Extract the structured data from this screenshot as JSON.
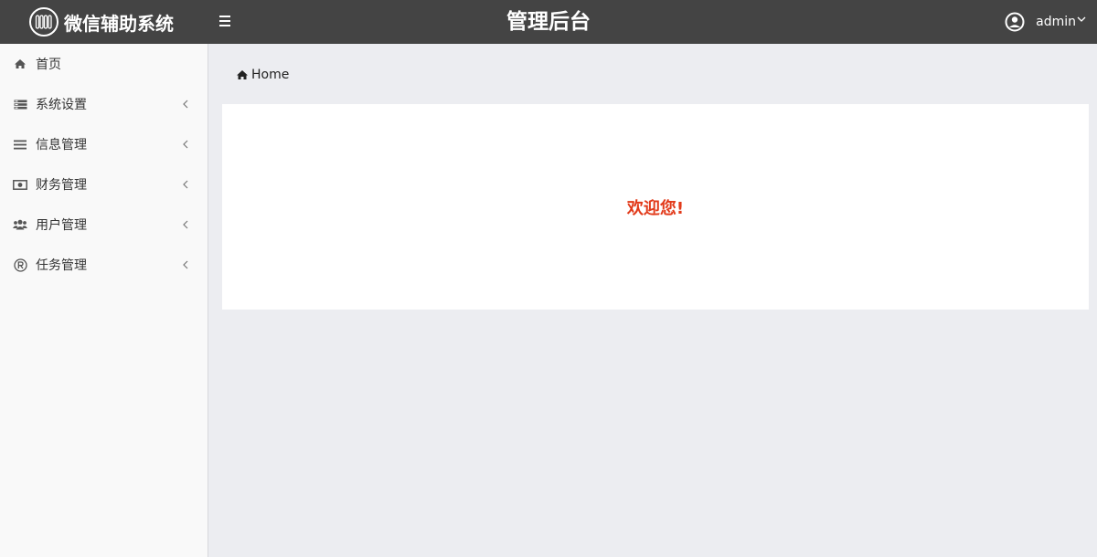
{
  "header": {
    "brand_title": "微信辅助系统",
    "center_title": "管理后台",
    "user_name": "admin"
  },
  "sidebar": {
    "items": [
      {
        "label": "首页",
        "icon": "home-icon",
        "has_submenu": false
      },
      {
        "label": "系统设置",
        "icon": "server-icon",
        "has_submenu": true
      },
      {
        "label": "信息管理",
        "icon": "list-icon",
        "has_submenu": true
      },
      {
        "label": "财务管理",
        "icon": "money-icon",
        "has_submenu": true
      },
      {
        "label": "用户管理",
        "icon": "users-icon",
        "has_submenu": true
      },
      {
        "label": "任务管理",
        "icon": "registered-icon",
        "has_submenu": true
      }
    ]
  },
  "breadcrumb": {
    "home_label": "Home"
  },
  "content": {
    "welcome_text": "欢迎您!"
  },
  "colors": {
    "topbar": "#444444",
    "sidebar": "#f9f9f9",
    "main_bg": "#ecedf1",
    "welcome": "#e23a1a"
  }
}
